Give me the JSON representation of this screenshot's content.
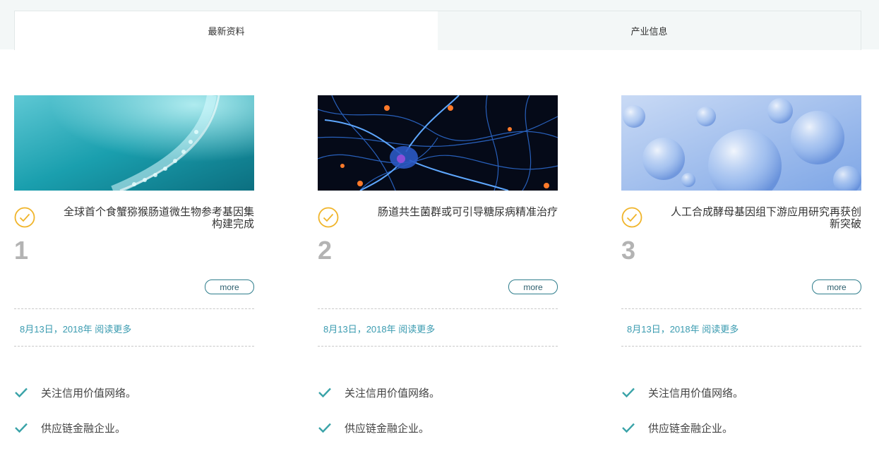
{
  "tabs": [
    {
      "label": "最新资料"
    },
    {
      "label": "产业信息"
    }
  ],
  "cards": [
    {
      "title": "全球首个食蟹猕猴肠道微生物参考基因集构建完成",
      "number": "1",
      "more_label": "more",
      "date": "8月13日，2018年",
      "read_more": "阅读更多",
      "features": [
        "关注信用价值网络。",
        "供应链金融企业。"
      ]
    },
    {
      "title": "肠道共生菌群或可引导糖尿病精准治疗",
      "number": "2",
      "more_label": "more",
      "date": "8月13日，2018年",
      "read_more": "阅读更多",
      "features": [
        "关注信用价值网络。",
        "供应链金融企业。"
      ]
    },
    {
      "title": "人工合成酵母基因组下游应用研究再获创新突破",
      "number": "3",
      "more_label": "more",
      "date": "8月13日，2018年",
      "read_more": "阅读更多",
      "features": [
        "关注信用价值网络。",
        "供应链金融企业。"
      ]
    }
  ],
  "colors": {
    "accent_teal": "#3a9bb0",
    "check_orange": "#f0b429",
    "number_gray": "#b3b3b3"
  }
}
